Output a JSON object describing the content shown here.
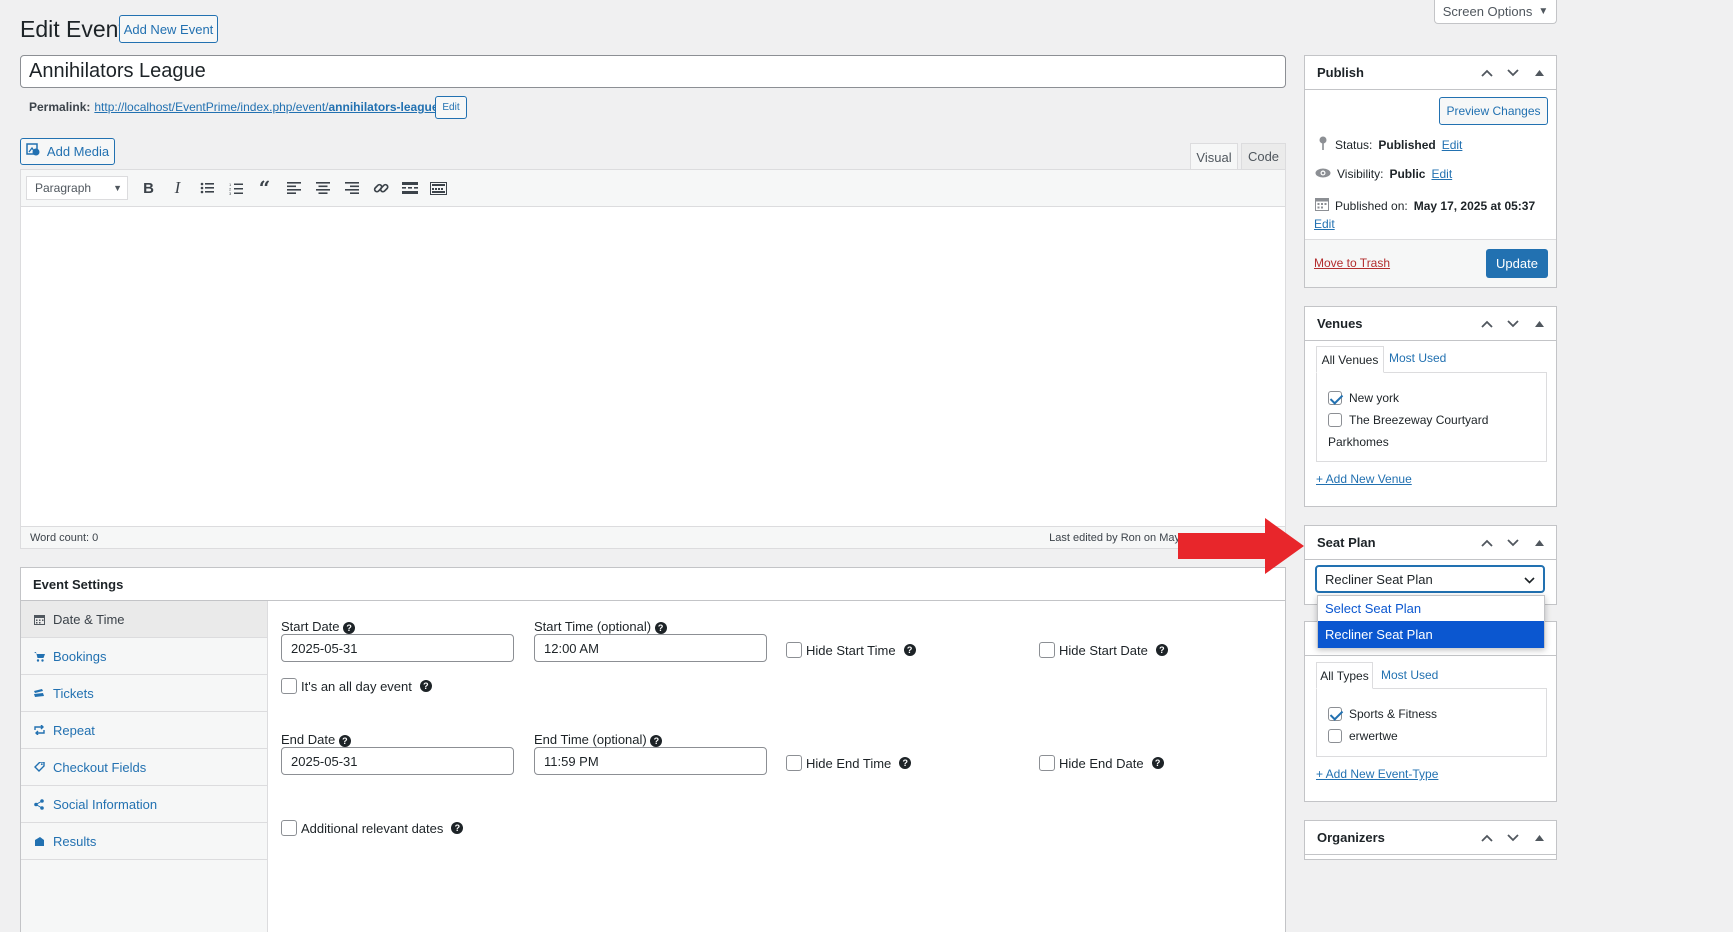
{
  "header": {
    "title": "Edit Event",
    "add_new_label": "Add New Event",
    "screen_options_label": "Screen Options"
  },
  "post": {
    "title_value": "Annihilators League",
    "permalink_label": "Permalink:",
    "permalink_base": "http://localhost/EventPrime/index.php/event/",
    "permalink_slug": "annihilators-league",
    "permalink_trailing": "/",
    "permalink_edit_label": "Edit"
  },
  "editor": {
    "add_media_label": "Add Media",
    "tab_visual": "Visual",
    "tab_code": "Code",
    "format_select_value": "Paragraph",
    "word_count": "Word count: 0",
    "last_edited": "Last edited by Ron on May"
  },
  "event_settings": {
    "title": "Event Settings",
    "nav": [
      {
        "label": "Date & Time",
        "icon": "calendar-icon"
      },
      {
        "label": "Bookings",
        "icon": "cart-icon"
      },
      {
        "label": "Tickets",
        "icon": "tickets-icon"
      },
      {
        "label": "Repeat",
        "icon": "repeat-icon"
      },
      {
        "label": "Checkout Fields",
        "icon": "tag-icon"
      },
      {
        "label": "Social Information",
        "icon": "share-icon"
      },
      {
        "label": "Results",
        "icon": "results-icon"
      }
    ],
    "start_date_label": "Start Date",
    "start_date_value": "2025-05-31",
    "start_time_label": "Start Time (optional)",
    "start_time_value": "12:00 AM",
    "hide_start_time": "Hide Start Time",
    "hide_start_date": "Hide Start Date",
    "all_day_label": "It's an all day event",
    "end_date_label": "End Date",
    "end_date_value": "2025-05-31",
    "end_time_label": "End Time (optional)",
    "end_time_value": "11:59 PM",
    "hide_end_time": "Hide End Time",
    "hide_end_date": "Hide End Date",
    "additional_dates_label": "Additional relevant dates"
  },
  "publish": {
    "title": "Publish",
    "preview_label": "Preview Changes",
    "status_label": "Status:",
    "status_value": "Published",
    "visibility_label": "Visibility:",
    "visibility_value": "Public",
    "published_on_label": "Published on:",
    "published_on_value": "May 17, 2025 at 05:37",
    "edit_label": "Edit",
    "trash_label": "Move to Trash",
    "update_label": "Update"
  },
  "venues": {
    "title": "Venues",
    "tab_all": "All Venues",
    "tab_most": "Most Used",
    "items": [
      {
        "label": "New york",
        "checked": true
      },
      {
        "label": "The Breezeway Courtyard",
        "checked": false
      }
    ],
    "partial_item": "Parkhomes",
    "add_new": "+ Add New Venue"
  },
  "seat_plan": {
    "title": "Seat Plan",
    "selected": "Recliner Seat Plan",
    "options": [
      "Select Seat Plan",
      "Recliner Seat Plan"
    ]
  },
  "event_types": {
    "tab_all": "All Types",
    "tab_most": "Most Used",
    "items": [
      {
        "label": "Sports & Fitness",
        "checked": true
      },
      {
        "label": "erwertwe",
        "checked": false
      }
    ],
    "add_new": "+ Add New Event-Type"
  },
  "organizers": {
    "title": "Organizers"
  },
  "colors": {
    "accent": "#2271b1",
    "arrow": "#e8262b",
    "trash": "#b32d2e",
    "selected_option": "#0b57d0"
  }
}
